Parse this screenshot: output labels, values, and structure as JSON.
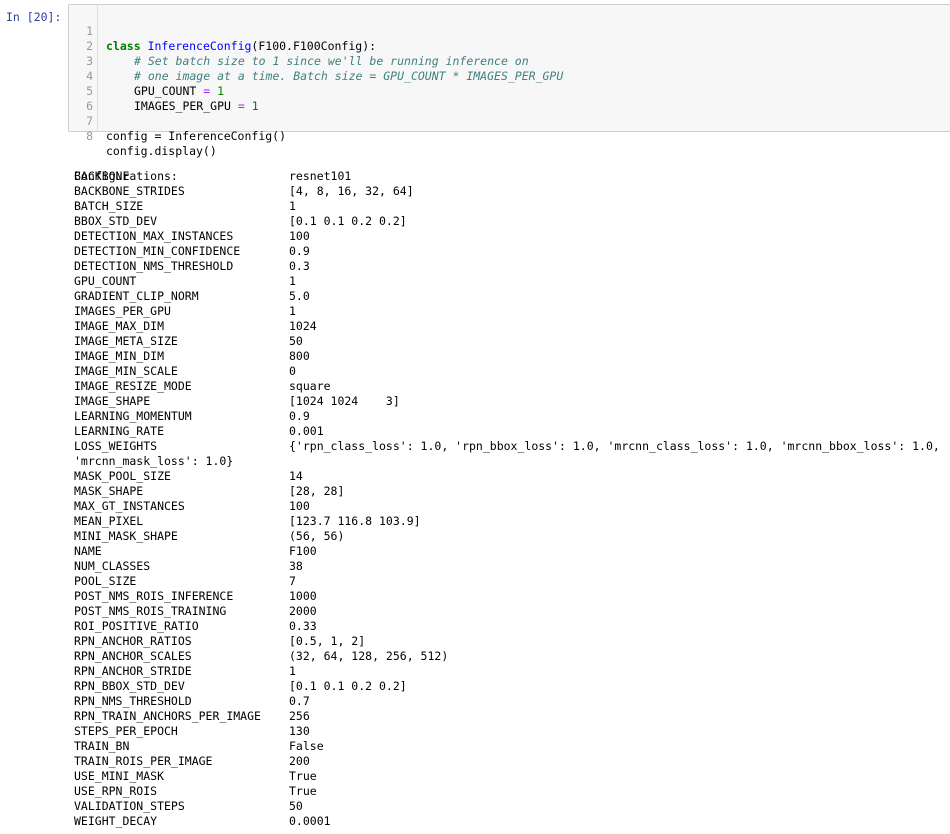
{
  "prompt": "In [20]:",
  "code": {
    "class_kw": "class",
    "class_name": "InferenceConfig",
    "class_base": "(F100.F100Config):",
    "comment1": "# Set batch size to 1 since we'll be running inference on",
    "comment2": "# one image at a time. Batch size = GPU_COUNT * IMAGES_PER_GPU",
    "gpu_name": "GPU_COUNT",
    "gpu_eq": " = ",
    "gpu_val": "1",
    "ipg_name": "IMAGES_PER_GPU",
    "ipg_eq": " = ",
    "ipg_val": "1",
    "line7": "config = InferenceConfig()",
    "line8": "config.display()",
    "line_numbers": [
      "1",
      "2",
      "3",
      "4",
      "5",
      "6",
      "7",
      "8"
    ]
  },
  "output": {
    "header": "Configurations:",
    "rows": [
      [
        "BACKBONE",
        "resnet101"
      ],
      [
        "BACKBONE_STRIDES",
        "[4, 8, 16, 32, 64]"
      ],
      [
        "BATCH_SIZE",
        "1"
      ],
      [
        "BBOX_STD_DEV",
        "[0.1 0.1 0.2 0.2]"
      ],
      [
        "DETECTION_MAX_INSTANCES",
        "100"
      ],
      [
        "DETECTION_MIN_CONFIDENCE",
        "0.9"
      ],
      [
        "DETECTION_NMS_THRESHOLD",
        "0.3"
      ],
      [
        "GPU_COUNT",
        "1"
      ],
      [
        "GRADIENT_CLIP_NORM",
        "5.0"
      ],
      [
        "IMAGES_PER_GPU",
        "1"
      ],
      [
        "IMAGE_MAX_DIM",
        "1024"
      ],
      [
        "IMAGE_META_SIZE",
        "50"
      ],
      [
        "IMAGE_MIN_DIM",
        "800"
      ],
      [
        "IMAGE_MIN_SCALE",
        "0"
      ],
      [
        "IMAGE_RESIZE_MODE",
        "square"
      ],
      [
        "IMAGE_SHAPE",
        "[1024 1024    3]"
      ],
      [
        "LEARNING_MOMENTUM",
        "0.9"
      ],
      [
        "LEARNING_RATE",
        "0.001"
      ],
      [
        "LOSS_WEIGHTS",
        "{'rpn_class_loss': 1.0, 'rpn_bbox_loss': 1.0, 'mrcnn_class_loss': 1.0, 'mrcnn_bbox_loss': 1.0,"
      ],
      [
        "",
        "'mrcnn_mask_loss': 1.0}"
      ],
      [
        "MASK_POOL_SIZE",
        "14"
      ],
      [
        "MASK_SHAPE",
        "[28, 28]"
      ],
      [
        "MAX_GT_INSTANCES",
        "100"
      ],
      [
        "MEAN_PIXEL",
        "[123.7 116.8 103.9]"
      ],
      [
        "MINI_MASK_SHAPE",
        "(56, 56)"
      ],
      [
        "NAME",
        "F100"
      ],
      [
        "NUM_CLASSES",
        "38"
      ],
      [
        "POOL_SIZE",
        "7"
      ],
      [
        "POST_NMS_ROIS_INFERENCE",
        "1000"
      ],
      [
        "POST_NMS_ROIS_TRAINING",
        "2000"
      ],
      [
        "ROI_POSITIVE_RATIO",
        "0.33"
      ],
      [
        "RPN_ANCHOR_RATIOS",
        "[0.5, 1, 2]"
      ],
      [
        "RPN_ANCHOR_SCALES",
        "(32, 64, 128, 256, 512)"
      ],
      [
        "RPN_ANCHOR_STRIDE",
        "1"
      ],
      [
        "RPN_BBOX_STD_DEV",
        "[0.1 0.1 0.2 0.2]"
      ],
      [
        "RPN_NMS_THRESHOLD",
        "0.7"
      ],
      [
        "RPN_TRAIN_ANCHORS_PER_IMAGE",
        "256"
      ],
      [
        "STEPS_PER_EPOCH",
        "130"
      ],
      [
        "TRAIN_BN",
        "False"
      ],
      [
        "TRAIN_ROIS_PER_IMAGE",
        "200"
      ],
      [
        "USE_MINI_MASK",
        "True"
      ],
      [
        "USE_RPN_ROIS",
        "True"
      ],
      [
        "VALIDATION_STEPS",
        "50"
      ],
      [
        "WEIGHT_DECAY",
        "0.0001"
      ]
    ]
  }
}
